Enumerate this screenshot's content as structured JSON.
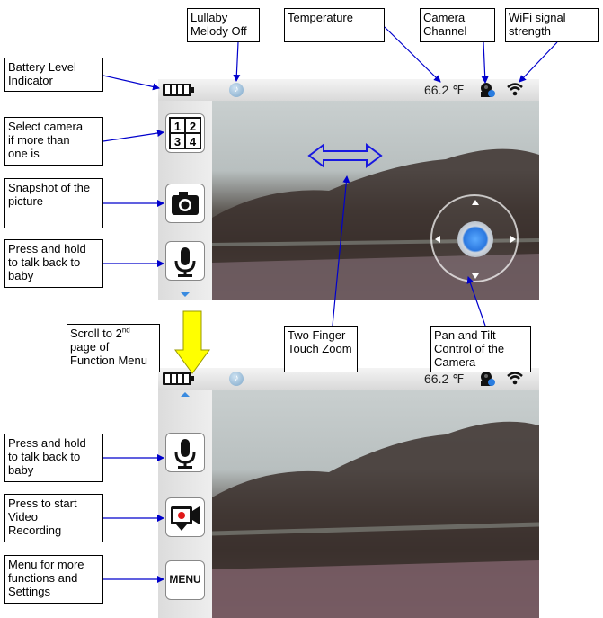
{
  "callouts": {
    "battery": "Battery Level\nIndicator",
    "lullaby": "Lullaby\nMelody Off",
    "temperature": "Temperature",
    "camera_channel": "Camera\nChannel",
    "wifi": "WiFi signal\nstrength",
    "select_camera": "Select camera\nif more than\none is",
    "snapshot": "Snapshot of the\npicture",
    "talk_back_top": "Press and hold\nto talk back to\nbaby",
    "scroll_prefix": "Scroll to 2",
    "scroll_sup": "nd",
    "scroll_suffix": "page of\nFunction Menu",
    "two_finger": "Two Finger\nTouch Zoom",
    "pan_tilt": "Pan and Tilt\nControl of the\nCamera",
    "talk_back_bottom": "Press and hold\nto talk back to\nbaby",
    "record": "Press to start\nVideo\nRecording",
    "menu": "Menu for more\nfunctions and\nSettings"
  },
  "screen1": {
    "temperature": "66.2 ℉",
    "buttons": [
      "camera-select-icon",
      "camera-icon",
      "microphone-icon"
    ],
    "camera_select_digits": [
      "1",
      "2",
      "3",
      "4"
    ]
  },
  "screen2": {
    "temperature": "66.2 ℉",
    "menu_label": "MENU",
    "buttons": [
      "microphone-icon",
      "video-record-icon",
      "menu-icon"
    ]
  },
  "colors": {
    "arrow": "#0000cc",
    "accent": "#3a8be0",
    "scroll_arrow": "#ffff00"
  }
}
